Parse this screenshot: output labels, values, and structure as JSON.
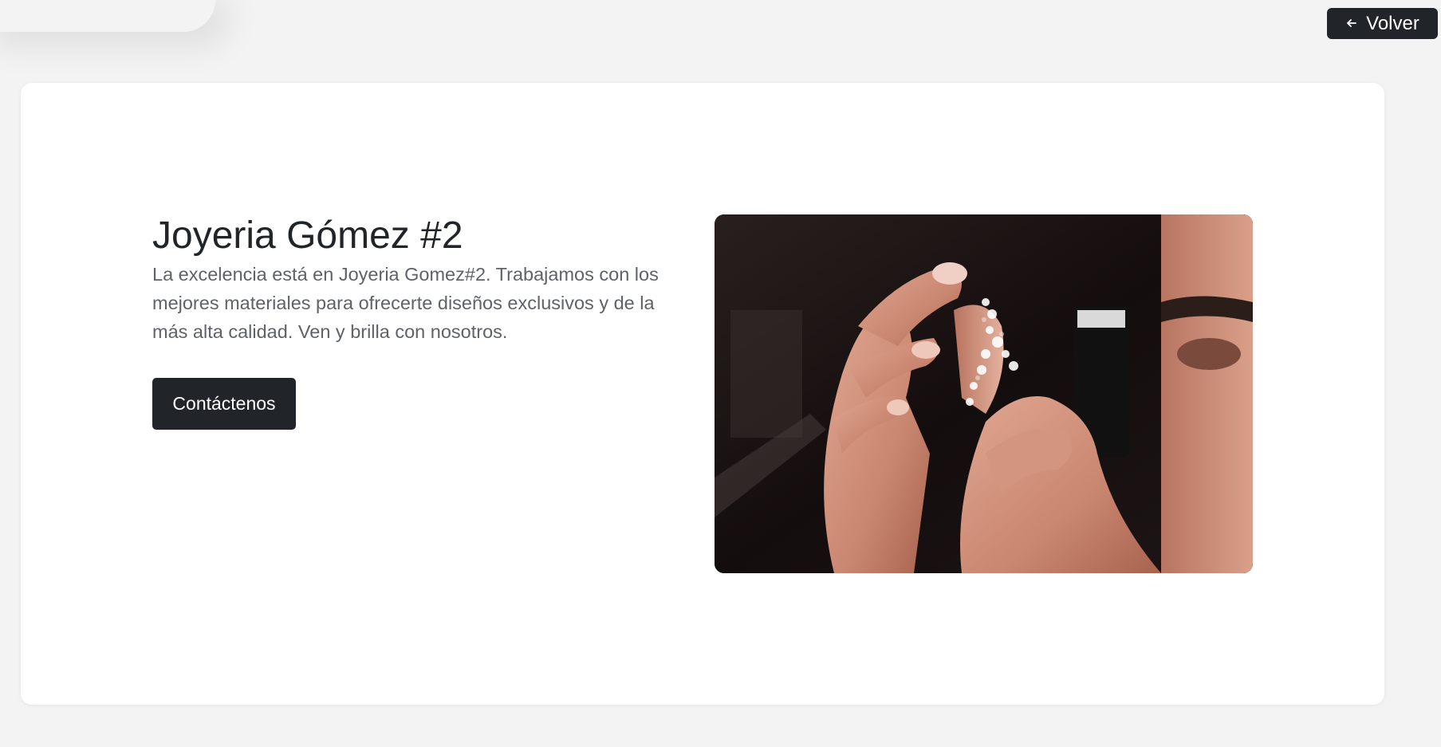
{
  "header": {
    "back_label": "Volver",
    "back_icon": "arrow-left-icon"
  },
  "hero": {
    "title": "Joyeria Gómez #2",
    "description": "La excelencia está en Joyeria Gomez#2. Trabajamos con los mejores materiales para ofrecerte diseños exclusivos y de la más alta calidad. Ven y brilla con nosotros.",
    "cta_label": "Contáctenos",
    "image_subject": "jeweler-inspecting-diamond-earring-photo"
  },
  "colors": {
    "background": "#f3f3f3",
    "card": "#ffffff",
    "button": "#212529",
    "title_text": "#212529",
    "body_text": "#5f6368"
  }
}
